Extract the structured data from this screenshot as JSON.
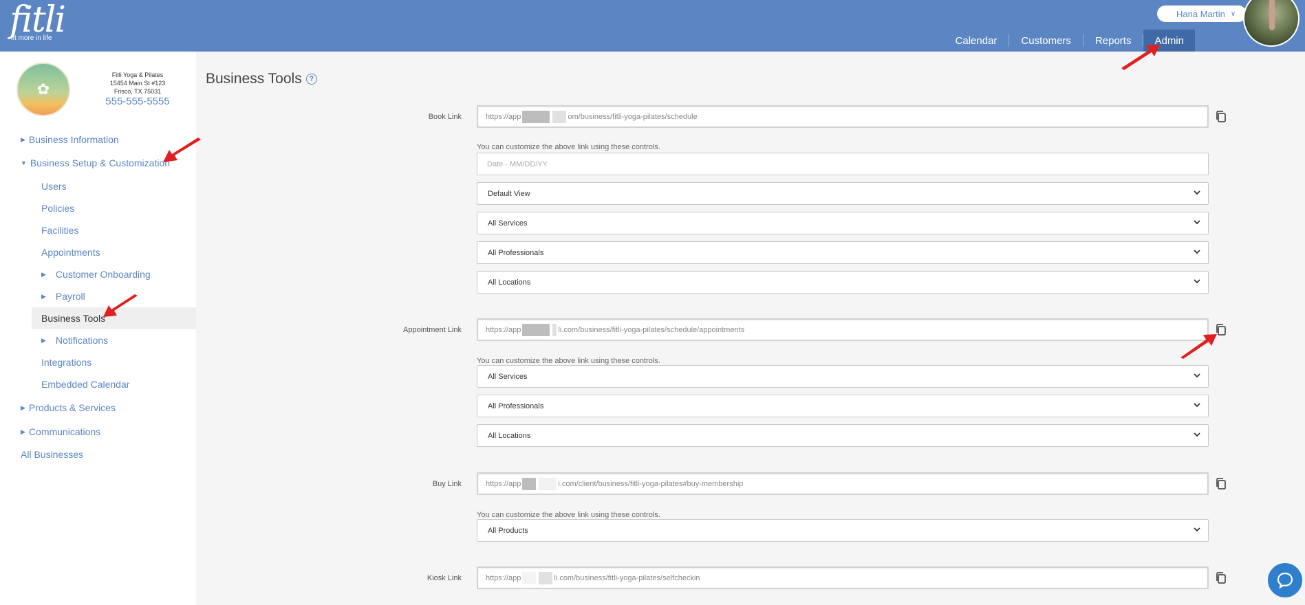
{
  "header": {
    "logo_word": "fitli",
    "logo_tagline": "fit more in life",
    "user_name": "Hana Martin",
    "nav": [
      {
        "label": "Calendar",
        "active": false
      },
      {
        "label": "Customers",
        "active": false
      },
      {
        "label": "Reports",
        "active": false
      },
      {
        "label": "Admin",
        "active": true
      }
    ]
  },
  "sidebar": {
    "business_name": "Fitli Yoga & Pilates",
    "address_line1": "15454 Main St #123",
    "address_line2": "Frisco, TX 75031",
    "phone": "555-555-5555",
    "items": [
      {
        "label": "Business Information"
      },
      {
        "label": "Business Setup & Customization"
      },
      {
        "label": "Users"
      },
      {
        "label": "Policies"
      },
      {
        "label": "Facilities"
      },
      {
        "label": "Appointments"
      },
      {
        "label": "Customer Onboarding"
      },
      {
        "label": "Payroll"
      },
      {
        "label": "Business Tools"
      },
      {
        "label": "Notifications"
      },
      {
        "label": "Integrations"
      },
      {
        "label": "Embedded Calendar"
      },
      {
        "label": "Products & Services"
      },
      {
        "label": "Communications"
      },
      {
        "label": "All Businesses"
      }
    ]
  },
  "main": {
    "title": "Business Tools",
    "help_glyph": "?",
    "hint": "You can customize the above link using these controls.",
    "book": {
      "label": "Book Link",
      "url_start": "https://app",
      "url_end": "om/business/fitli-yoga-pilates/schedule",
      "date_placeholder": "Date - MM/DD/YY",
      "selects": [
        "Default View",
        "All Services",
        "All Professionals",
        "All Locations"
      ]
    },
    "appointment": {
      "label": "Appointment Link",
      "url_start": "https://app",
      "url_end": "li.com/business/fitli-yoga-pilates/schedule/appointments",
      "selects": [
        "All Services",
        "All Professionals",
        "All Locations"
      ]
    },
    "buy": {
      "label": "Buy Link",
      "url_start": "https://app",
      "url_end": "i.com/client/business/fitli-yoga-pilates#buy-membership",
      "selects": [
        "All Products"
      ]
    },
    "kiosk": {
      "label": "Kiosk Link",
      "url_start": "https://app",
      "url_end": "li.com/business/fitli-yoga-pilates/selfcheckin"
    }
  },
  "colors": {
    "header": "#5b86c3",
    "nav_active": "#3f6aa6",
    "link": "#5b86c3",
    "annotation_arrow": "#e02020",
    "chat": "#2f7fcc"
  }
}
